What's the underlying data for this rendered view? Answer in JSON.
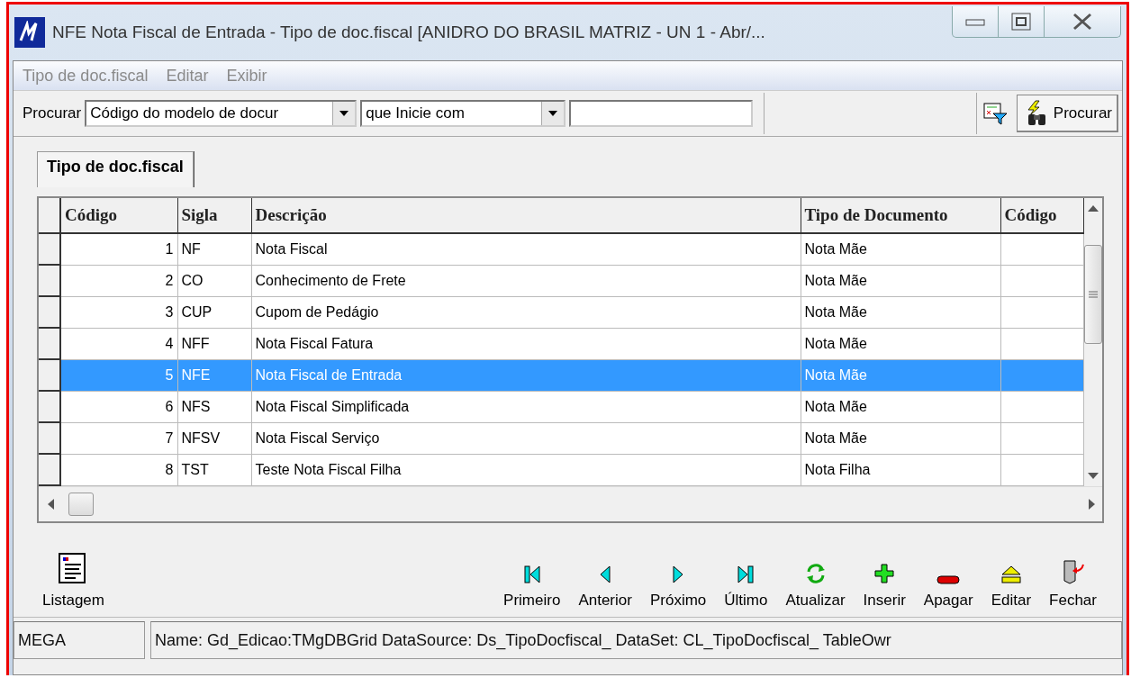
{
  "window": {
    "title": "NFE Nota Fiscal de Entrada -  Tipo de doc.fiscal [ANIDRO DO BRASIL MATRIZ - UN 1 - Abr/..."
  },
  "menu": [
    {
      "label": "Tipo de doc.fiscal",
      "disabled": true
    },
    {
      "label": "Editar",
      "disabled": true
    },
    {
      "label": "Exibir",
      "disabled": true
    }
  ],
  "search": {
    "label": "Procurar",
    "field": "Código do modelo de docur",
    "condition": "que Inicie com",
    "button": "Procurar"
  },
  "tabs": [
    {
      "label": "Tipo de doc.fiscal",
      "selected": true
    }
  ],
  "table": {
    "columns": [
      "Código",
      "Sigla",
      "Descrição",
      "Tipo de Documento",
      "Código"
    ],
    "rows": [
      {
        "cells": [
          "1",
          "NF",
          "Nota Fiscal",
          "Nota Mãe"
        ],
        "selected": false
      },
      {
        "cells": [
          "2",
          "CO",
          "Conhecimento de Frete",
          "Nota Mãe"
        ],
        "selected": false
      },
      {
        "cells": [
          "3",
          "CUP",
          "Cupom de Pedágio",
          "Nota Mãe"
        ],
        "selected": false
      },
      {
        "cells": [
          "4",
          "NFF",
          "Nota Fiscal Fatura",
          "Nota Mãe"
        ],
        "selected": false
      },
      {
        "cells": [
          "5",
          "NFE",
          "Nota Fiscal de Entrada",
          "Nota Mãe"
        ],
        "selected": true
      },
      {
        "cells": [
          "6",
          "NFS",
          "Nota Fiscal Simplificada",
          "Nota Mãe"
        ],
        "selected": false
      },
      {
        "cells": [
          "7",
          "NFSV",
          "Nota Fiscal Serviço",
          "Nota Mãe"
        ],
        "selected": false
      },
      {
        "cells": [
          "8",
          "TST",
          "Teste Nota Fiscal Filha",
          "Nota Filha"
        ],
        "selected": false
      }
    ]
  },
  "actions": [
    {
      "label": "Listagem",
      "kind": "report"
    },
    {
      "label": "Primeiro",
      "kind": "first"
    },
    {
      "label": "Anterior",
      "kind": "prev"
    },
    {
      "label": "Próximo",
      "kind": "next"
    },
    {
      "label": "Último",
      "kind": "last"
    },
    {
      "label": "Atualizar",
      "kind": "refresh"
    },
    {
      "label": "Inserir",
      "kind": "insert"
    },
    {
      "label": "Apagar",
      "kind": "delete"
    },
    {
      "label": "Editar",
      "kind": "edit"
    },
    {
      "label": "Fechar",
      "kind": "close"
    }
  ],
  "status_bar": [
    "MEGA",
    "Name: Gd_Edicao:TMgDBGrid DataSource: Ds_TipoDocfiscal_ DataSet: CL_TipoDocfiscal_ TableOwr"
  ]
}
